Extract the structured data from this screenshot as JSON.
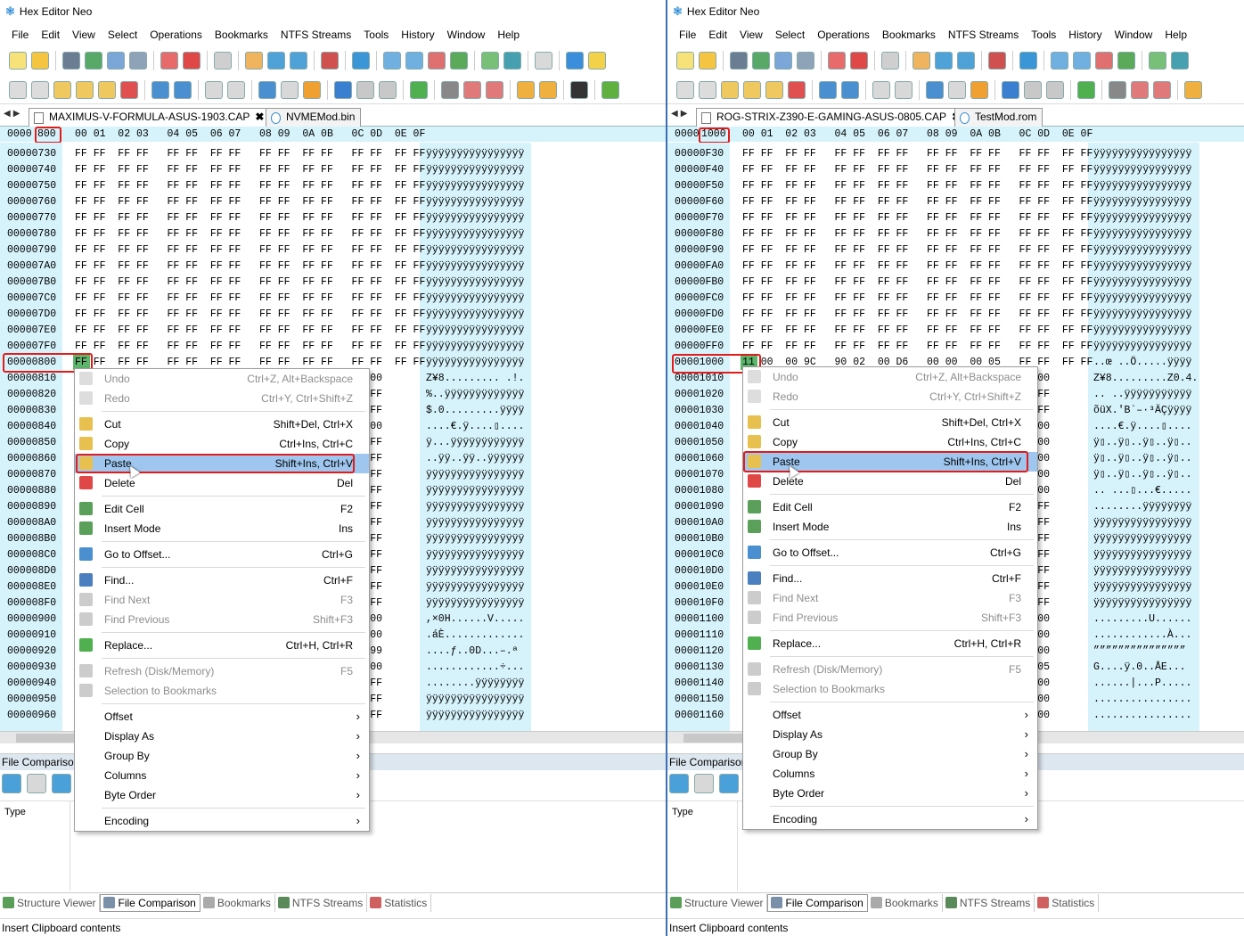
{
  "app_title": "Hex Editor Neo",
  "menu": [
    "File",
    "Edit",
    "View",
    "Select",
    "Operations",
    "Bookmarks",
    "NTFS Streams",
    "Tools",
    "History",
    "Window",
    "Help"
  ],
  "hex_header_cols": "00 01  02 03   04 05  06 07   08 09  0A 0B   0C 0D  0E 0F",
  "colors": {
    "accent": "#3b6fb6",
    "highlight_red": "#e21b1b",
    "hex_bg": "#d6f3fb",
    "selected_menu": "#9ec6ee",
    "cell_green": "#5cb56b"
  },
  "left": {
    "tabs": [
      "MAXIMUS-V-FORMULA-ASUS-1903.CAP",
      "NVMEMod.bin"
    ],
    "tab_close": "✖",
    "header_offset_prefix": "0000",
    "header_offset_value": "800",
    "offsets": "00000730\n00000740\n00000750\n00000760\n00000770\n00000780\n00000790\n000007A0\n000007B0\n000007C0\n000007D0\n000007E0\n000007F0\n00000800\n00000810\n00000820\n00000830\n00000840\n00000850\n00000860\n00000870\n00000880\n00000890\n000008A0\n000008B0\n000008C0\n000008D0\n000008E0\n000008F0\n00000900\n00000910\n00000920\n00000930\n00000940\n00000950\n00000960",
    "hex_rows": "FF FF  FF FF   FF FF  FF FF   FF FF  FF FF   FF FF  FF FF\nFF FF  FF FF   FF FF  FF FF   FF FF  FF FF   FF FF  FF FF\nFF FF  FF FF   FF FF  FF FF   FF FF  FF FF   FF FF  FF FF\nFF FF  FF FF   FF FF  FF FF   FF FF  FF FF   FF FF  FF FF\nFF FF  FF FF   FF FF  FF FF   FF FF  FF FF   FF FF  FF FF\nFF FF  FF FF   FF FF  FF FF   FF FF  FF FF   FF FF  FF FF\nFF FF  FF FF   FF FF  FF FF   FF FF  FF FF   FF FF  FF FF\nFF FF  FF FF   FF FF  FF FF   FF FF  FF FF   FF FF  FF FF\nFF FF  FF FF   FF FF  FF FF   FF FF  FF FF   FF FF  FF FF\nFF FF  FF FF   FF FF  FF FF   FF FF  FF FF   FF FF  FF FF\nFF FF  FF FF   FF FF  FF FF   FF FF  FF FF   FF FF  FF FF\nFF FF  FF FF   FF FF  FF FF   FF FF  FF FF   FF FF  FF FF\nFF FF  FF FF   FF FF  FF FF   FF FF  FF FF   FF FF  FF FF\nFF FF  FF FF   FF FF  FF FF   FF FF  FF FF   FF FF  FF FF\n                                             21 00\n                                             FF FF\n                                             FF FF\n                                             02 00\n                                             FF FF\n                                             FF FF\n                                             FF FF\n                                             FF FF\n                                             FF FF\n                                             FF FF\n                                             FF FF\n                                             FF FF\n                                             FF FF\n                                             FF FF\n                                             FF FF\n                                             00 00\n                                             00 00\n                                             00 99\n                                             00 00\n                                             FF FF\n                                             FF FF\n                                             FF FF",
    "ascii_rows": "ÿÿÿÿÿÿÿÿÿÿÿÿÿÿÿÿ\nÿÿÿÿÿÿÿÿÿÿÿÿÿÿÿÿ\nÿÿÿÿÿÿÿÿÿÿÿÿÿÿÿÿ\nÿÿÿÿÿÿÿÿÿÿÿÿÿÿÿÿ\nÿÿÿÿÿÿÿÿÿÿÿÿÿÿÿÿ\nÿÿÿÿÿÿÿÿÿÿÿÿÿÿÿÿ\nÿÿÿÿÿÿÿÿÿÿÿÿÿÿÿÿ\nÿÿÿÿÿÿÿÿÿÿÿÿÿÿÿÿ\nÿÿÿÿÿÿÿÿÿÿÿÿÿÿÿÿ\nÿÿÿÿÿÿÿÿÿÿÿÿÿÿÿÿ\nÿÿÿÿÿÿÿÿÿÿÿÿÿÿÿÿ\nÿÿÿÿÿÿÿÿÿÿÿÿÿÿÿÿ\nÿÿÿÿÿÿÿÿÿÿÿÿÿÿÿÿ\nÿÿÿÿÿÿÿÿÿÿÿÿÿÿÿÿ\nZ¥8......... .!.\n%..ÿÿÿÿÿÿÿÿÿÿÿÿÿ\n$.0.........ÿÿÿÿ\n....€.ÿ....▯....\nÿ...ÿÿÿÿÿÿÿÿÿÿÿÿ\n..ÿÿ..ÿÿ..ÿÿÿÿÿÿ\nÿÿÿÿÿÿÿÿÿÿÿÿÿÿÿÿ\nÿÿÿÿÿÿÿÿÿÿÿÿÿÿÿÿ\nÿÿÿÿÿÿÿÿÿÿÿÿÿÿÿÿ\nÿÿÿÿÿÿÿÿÿÿÿÿÿÿÿÿ\nÿÿÿÿÿÿÿÿÿÿÿÿÿÿÿÿ\nÿÿÿÿÿÿÿÿÿÿÿÿÿÿÿÿ\nÿÿÿÿÿÿÿÿÿÿÿÿÿÿÿÿ\nÿÿÿÿÿÿÿÿÿÿÿÿÿÿÿÿ\nÿÿÿÿÿÿÿÿÿÿÿÿÿÿÿÿ\n,×0H......V.....\n.áÈ.............\n....ƒ..0D...–.ª\n............÷...\n........ÿÿÿÿÿÿÿÿ\nÿÿÿÿÿÿÿÿÿÿÿÿÿÿÿÿ\nÿÿÿÿÿÿÿÿÿÿÿÿÿÿÿÿ"
  },
  "right": {
    "tabs": [
      "ROG-STRIX-Z390-E-GAMING-ASUS-0805.CAP",
      "TestMod.rom"
    ],
    "tab_close": "✖",
    "header_offset_prefix": "0000",
    "header_offset_value": "1000",
    "offsets": "00000F30\n00000F40\n00000F50\n00000F60\n00000F70\n00000F80\n00000F90\n00000FA0\n00000FB0\n00000FC0\n00000FD0\n00000FE0\n00000FF0\n00001000\n00001010\n00001020\n00001030\n00001040\n00001050\n00001060\n00001070\n00001080\n00001090\n000010A0\n000010B0\n000010C0\n000010D0\n000010E0\n000010F0\n00001100\n00001110\n00001120\n00001130\n00001140\n00001150\n00001160",
    "hex_rows": "FF FF  FF FF   FF FF  FF FF   FF FF  FF FF   FF FF  FF FF\nFF FF  FF FF   FF FF  FF FF   FF FF  FF FF   FF FF  FF FF\nFF FF  FF FF   FF FF  FF FF   FF FF  FF FF   FF FF  FF FF\nFF FF  FF FF   FF FF  FF FF   FF FF  FF FF   FF FF  FF FF\nFF FF  FF FF   FF FF  FF FF   FF FF  FF FF   FF FF  FF FF\nFF FF  FF FF   FF FF  FF FF   FF FF  FF FF   FF FF  FF FF\nFF FF  FF FF   FF FF  FF FF   FF FF  FF FF   FF FF  FF FF\nFF FF  FF FF   FF FF  FF FF   FF FF  FF FF   FF FF  FF FF\nFF FF  FF FF   FF FF  FF FF   FF FF  FF FF   FF FF  FF FF\nFF FF  FF FF   FF FF  FF FF   FF FF  FF FF   FF FF  FF FF\nFF FF  FF FF   FF FF  FF FF   FF FF  FF FF   FF FF  FF FF\nFF FF  FF FF   FF FF  FF FF   FF FF  FF FF   FF FF  FF FF\nFF FF  FF FF   FF FF  FF FF   FF FF  FF FF   FF FF  FF FF\n11 00  00 9C   90 02  00 D6   00 00  00 05   FF FF  FF FF\n                                             34 00\n                                             FF FF\n                                             FF FF\n                                             02 00\n                                             00 00\n                                             00 00\n                                             00 00\n                                             00 00\n                                             FF FF\n                                             FF FF\n                                             FF FF\n                                             FF FF\n                                             FF FF\n                                             FF FF\n                                             FF FF\n                                             00 00\n                                             00 00\n                                             00 00\n                                             00 05\n                                             00 00\n                                             00 00\n                                             00 00",
    "ascii_rows": "ÿÿÿÿÿÿÿÿÿÿÿÿÿÿÿÿ\nÿÿÿÿÿÿÿÿÿÿÿÿÿÿÿÿ\nÿÿÿÿÿÿÿÿÿÿÿÿÿÿÿÿ\nÿÿÿÿÿÿÿÿÿÿÿÿÿÿÿÿ\nÿÿÿÿÿÿÿÿÿÿÿÿÿÿÿÿ\nÿÿÿÿÿÿÿÿÿÿÿÿÿÿÿÿ\nÿÿÿÿÿÿÿÿÿÿÿÿÿÿÿÿ\nÿÿÿÿÿÿÿÿÿÿÿÿÿÿÿÿ\nÿÿÿÿÿÿÿÿÿÿÿÿÿÿÿÿ\nÿÿÿÿÿÿÿÿÿÿÿÿÿÿÿÿ\nÿÿÿÿÿÿÿÿÿÿÿÿÿÿÿÿ\nÿÿÿÿÿÿÿÿÿÿÿÿÿÿÿÿ\nÿÿÿÿÿÿÿÿÿÿÿÿÿÿÿÿ\n..œ ..Ö.....ÿÿÿÿ\nZ¥8.........Z0.4.\n.. ..ÿÿÿÿÿÿÿÿÿÿÿ\nõüX.'B`–·³ÄÇÿÿÿÿ\n....€.ÿ....▯....\nÿ▯..ÿ▯..ÿ▯..ÿ▯..\nÿ▯..ÿ▯..ÿ▯..ÿ▯..\nÿ▯..ÿ▯..ÿ▯..ÿ▯..\n.. ...▯...€.....\n........ÿÿÿÿÿÿÿÿ\nÿÿÿÿÿÿÿÿÿÿÿÿÿÿÿÿ\nÿÿÿÿÿÿÿÿÿÿÿÿÿÿÿÿ\nÿÿÿÿÿÿÿÿÿÿÿÿÿÿÿÿ\nÿÿÿÿÿÿÿÿÿÿÿÿÿÿÿÿ\nÿÿÿÿÿÿÿÿÿÿÿÿÿÿÿÿ\nÿÿÿÿÿÿÿÿÿÿÿÿÿÿÿÿ\n.........U......\n............À...\n”””””””””””””””\nG....ÿ.0..ÅE...\n......|...P.....\n................\n................"
  },
  "context_menu": {
    "undo": {
      "label": "Undo",
      "shortcut": "Ctrl+Z, Alt+Backspace"
    },
    "redo": {
      "label": "Redo",
      "shortcut": "Ctrl+Y, Ctrl+Shift+Z"
    },
    "cut": {
      "label": "Cut",
      "shortcut": "Shift+Del, Ctrl+X"
    },
    "copy": {
      "label": "Copy",
      "shortcut": "Ctrl+Ins, Ctrl+C"
    },
    "paste": {
      "label": "Paste",
      "shortcut": "Shift+Ins, Ctrl+V"
    },
    "delete": {
      "label": "Delete",
      "shortcut": "Del"
    },
    "edit_cell": {
      "label": "Edit Cell",
      "shortcut": "F2"
    },
    "insert_mode": {
      "label": "Insert Mode",
      "shortcut": "Ins"
    },
    "goto_offset": {
      "label": "Go to Offset...",
      "shortcut": "Ctrl+G"
    },
    "find": {
      "label": "Find...",
      "shortcut": "Ctrl+F"
    },
    "find_next": {
      "label": "Find Next",
      "shortcut": "F3"
    },
    "find_previous": {
      "label": "Find Previous",
      "shortcut": "Shift+F3"
    },
    "replace": {
      "label": "Replace...",
      "shortcut": "Ctrl+H, Ctrl+R"
    },
    "refresh": {
      "label": "Refresh (Disk/Memory)",
      "shortcut": "F5"
    },
    "sel_bookmarks": {
      "label": "Selection to Bookmarks"
    },
    "offset": {
      "label": "Offset"
    },
    "display_as": {
      "label": "Display As"
    },
    "group_by": {
      "label": "Group By"
    },
    "columns": {
      "label": "Columns"
    },
    "byte_order": {
      "label": "Byte Order"
    },
    "encoding": {
      "label": "Encoding"
    },
    "submenu_arrow": "›"
  },
  "file_comparison": {
    "title": "File Comparison",
    "type_col": "Type"
  },
  "bottom_tabs": [
    "Structure Viewer",
    "File Comparison",
    "Bookmarks",
    "NTFS Streams",
    "Statistics"
  ],
  "status_text": "Insert Clipboard contents"
}
